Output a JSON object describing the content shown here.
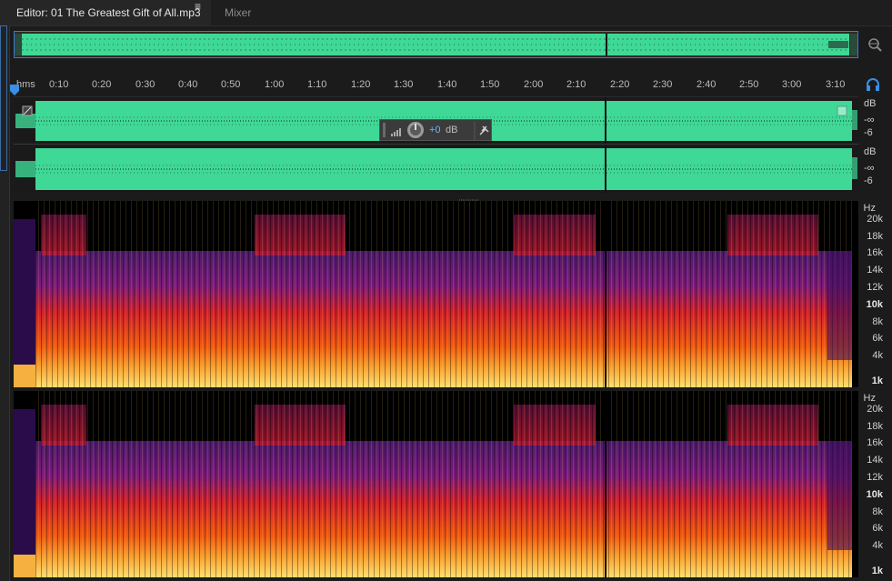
{
  "tabs": {
    "editor_label": "Editor: 01 The Greatest Gift of All.mp3",
    "menu_glyph": "≡",
    "mixer_label": "Mixer"
  },
  "ruler": {
    "unit": "hms",
    "labels": [
      "0:10",
      "0:20",
      "0:30",
      "0:40",
      "0:50",
      "1:00",
      "1:10",
      "1:20",
      "1:30",
      "1:40",
      "1:50",
      "2:00",
      "2:10",
      "2:20",
      "2:30",
      "2:40",
      "2:50",
      "3:00",
      "3:10"
    ]
  },
  "db_scale": {
    "ch1": [
      "dB",
      "-∞",
      "-6"
    ],
    "ch2": [
      "dB",
      "-∞",
      "-6"
    ]
  },
  "hud": {
    "value": "+0",
    "unit": "dB"
  },
  "hz_scale": {
    "labels": [
      "Hz",
      "20k",
      "18k",
      "16k",
      "14k",
      "12k",
      "10k",
      "8k",
      "6k",
      "4k",
      "1k"
    ]
  },
  "colors": {
    "waveform": "#3fd896",
    "selection_border": "#3a7bd5",
    "accent": "#3a8ee6"
  },
  "icons": [
    "zoom-icon",
    "headphone-icon",
    "playhead-icon",
    "volume-icon",
    "knob-icon",
    "pin-icon",
    "menu-icon"
  ]
}
